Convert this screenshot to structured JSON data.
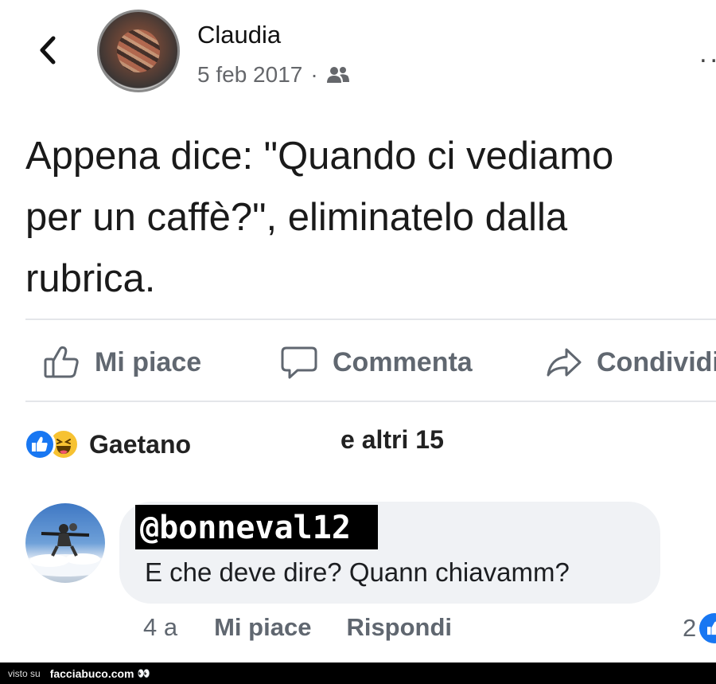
{
  "post": {
    "author": "Claudia",
    "date": "5 feb 2017",
    "separator": "·",
    "more": "..",
    "text_lines": [
      "Appena dice: \"Quando ci vediamo",
      "per un caffè?\", eliminatelo dalla",
      "rubrica."
    ]
  },
  "actions": {
    "like": "Mi piace",
    "comment": "Commenta",
    "share": "Condividi"
  },
  "reactions": {
    "name": "Gaetano",
    "others": "e altri 15",
    "types": [
      "like-icon",
      "haha-icon"
    ]
  },
  "comment": {
    "author": "@bonneval12",
    "text": "E che deve dire? Quann chiavamm?",
    "time": "4 a",
    "like": "Mi piace",
    "reply": "Rispondi",
    "reaction_count": "2"
  },
  "watermark": {
    "prefix": "visto su",
    "site": "facciabuco.com",
    "eyes": "👀"
  },
  "colors": {
    "like_blue": "#1877f2",
    "haha_yellow": "#f7c232",
    "secondary_text": "#65676b",
    "bubble_bg": "#f0f2f5"
  }
}
